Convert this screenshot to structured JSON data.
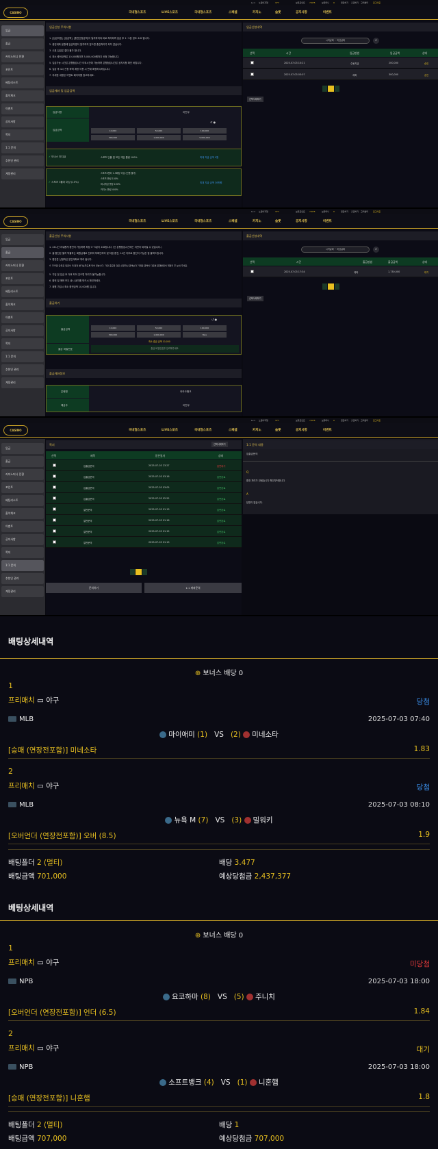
{
  "topbar": {
    "level": "Lv.1",
    "nick": "노원이지형",
    "points_label": "포인트",
    "points": "377",
    "bonus_label": "보유포인트",
    "bonus": "7,875",
    "money_label": "보유머니",
    "money": "0",
    "links": [
      "입금하기",
      "출금하기",
      "고객센터",
      "로그아웃"
    ]
  },
  "nav": {
    "logo": "CASINO",
    "items": [
      "국내형스포츠",
      "LIVE스포츠",
      "국내형스포츠",
      "스페셜",
      "카지노",
      "슬롯",
      "공지사항",
      "이벤트"
    ]
  },
  "sidebar": {
    "items": [
      "입금",
      "출금",
      "커지노머니 전환",
      "포인트",
      "베팅리스트",
      "출석체크",
      "이벤트",
      "공지사항",
      "쪽지",
      "1:1 문의",
      "추천인 관리",
      "계정관리"
    ]
  },
  "s1": {
    "sec1": "입금신청 주의사항",
    "notes": [
      "1. [입금지정], [입금액], [충전신청금액]이 일치하여야 바로 처리되며 입금 후 1~5분 정도 소요 됩니다.",
      "2. 충전계좌 문항에 입금자명이 일치하지 않으면 충전처리가 되지 않습니다.",
      "3. 수표 입금은 절대 불가 합니다.",
      "4. 최소 충전금액은 10,000원이며 5,000,000원까지 신청 가능합니다.",
      "5. 입금가능 시간은 은행점검시간 이외시간에 가능하며 은행점검시간은 공지사항 확인 바랍니다.",
      "6. 입금 후 4시 신청 하며 계정 이용 시 반재 확정하시하십니다.",
      "7. 자세한 내용은 이벤트 페이지를 참고하세요."
    ],
    "sec2": "입금계좌 및 입금금액",
    "depositor_label": "입금자명",
    "depositor": "이민우",
    "amount_label": "입금금액",
    "amounts": [
      "10,000",
      "50,000",
      "100,000",
      "300,000",
      "1,000,000",
      "5,000,000"
    ],
    "bonus1": "보너스 미지급",
    "bonus1_desc": "스포츠 단폴 및 모든 게임 롤링 100%",
    "bonus1_link": "최대 지급 금액 0원",
    "bonus2": "스포츠 3폴더 이상 (15%)",
    "bonus2_desc": [
      "스포츠3폴더 1.5배당 이상 (단폴 불가)",
      "스포츠 롤링 100%",
      "미니게임 롤링 150%",
      "카지노 롤링 400%"
    ],
    "bonus2_link": "최대 지급 금액 30만원",
    "r_sec": "입금신청내역",
    "date_from": "시작날짜",
    "date_to": "마감날짜",
    "th": [
      "선택",
      "시간",
      "입금방법",
      "입금금액",
      "상태"
    ],
    "rows": [
      [
        "2025-07-03 10:21",
        "수동지급",
        "200,000",
        "승인"
      ],
      [
        "2025-07-03 03:07",
        "계좌",
        "300,000",
        "승인"
      ]
    ],
    "page": "1",
    "del_btn": "선택삭제하기"
  },
  "s2": {
    "sec1": "출금신청 주의사항",
    "notes": [
      "1. 24시간 자유롭게 환전이 가능하며 최장 3~5분이 소요됩니다. (단 은행점검시간에는 지연이 되어질 수 있습니다.)",
      "2. 출·환전은 필히 박물하는 회원님께로 진위여 부확인하여 및 처음 환전, 14건 이후로 환전이 가능한 점 블랙드립니다.",
      "3. 환전은 신청하신 본인계좌로 처리 됩니다.",
      "4. 100원 단위로 입금이 미 환전 불가능하도록 되어 있습니다. 가장 중요한 것은 신청하신 금액보다 기재된 금액이 다르면 은행불일치 재정리 후 보내 주세요.",
      "5. 가입 및 입금 후 이후 되어 있으면 처리가 불가능합니다.",
      "6. 환전 및 매번 모두 공시 공지를 반드시 확인하세요.",
      "7. 회원 가입시 최소 환전금액 10,000원 입니다."
    ],
    "sec2": "출금하기",
    "amount_label": "출금금액",
    "amounts": [
      "10,000",
      "50,000",
      "100,000",
      "500,000",
      "1,000,000",
      "Max"
    ],
    "min_text": "최소 출금 금액 10,000",
    "pw_label": "출금 비밀번호",
    "pw_placeholder": "출금 비밀번호를 입력해주세요.",
    "sec3": "출금계좌정보",
    "bank_label": "은행명",
    "bank": "카카오뱅크",
    "holder_label": "예금주",
    "holder": "이민우",
    "r_sec": "출금신청내역",
    "date_from": "시작날짜",
    "date_to": "마감날짜",
    "th": [
      "선택",
      "시간",
      "출금방법",
      "출금금액",
      "상태"
    ],
    "rows": [
      [
        "2025-07-03 17:34",
        "계좌",
        "1,730,000",
        "대기"
      ]
    ],
    "page": "1",
    "del_btn": "선택삭제하기"
  },
  "s3": {
    "sec1": "쪽지",
    "del_btn": "선택삭제하기",
    "th": [
      "선택",
      "제목",
      "받은일자",
      "상태"
    ],
    "rows": [
      [
        "입출금문의",
        "2025-07-03 23:27",
        "답변대기"
      ],
      [
        "입출금문의",
        "2025-07-03 03:16",
        "답변완료"
      ],
      [
        "입출금문의",
        "2025-07-03 03:05",
        "답변완료"
      ],
      [
        "입출금문의",
        "2025-07-03 02:52",
        "답변완료"
      ],
      [
        "일반문의",
        "2025-07-03 01:13",
        "답변완료"
      ],
      [
        "일반문의",
        "2025-07-03 01:16",
        "답변완료"
      ],
      [
        "일반문의",
        "2025-07-03 01:15",
        "답변완료"
      ],
      [
        "일반문의",
        "2025-07-03 01:13",
        "답변완료"
      ]
    ],
    "page": "1",
    "btn_write": "문의하기",
    "btn_account": "1:1 계좌문의",
    "r_sec": "1:1 문의 내용",
    "r_title": "입출금문의",
    "q": "Q",
    "q_text": "환전 처리가 안됩습니다 확인부탁합니다",
    "a": "A",
    "a_text": "답변이 없습니다."
  },
  "d1": {
    "title": "배팅상세내역",
    "bonus": "보너스 배당 0",
    "games": [
      {
        "n": "1",
        "type": "프리매치",
        "sport": "야구",
        "status": "당첨",
        "league": "MLB",
        "time": "2025-07-03 07:40",
        "home": "마이애미",
        "hs": "(1)",
        "vs": "VS",
        "as": "(2)",
        "away": "미네소타",
        "pick": "[승패 (연장전포함)] 미네소타",
        "odd": "1.83"
      },
      {
        "n": "2",
        "type": "프리매치",
        "sport": "야구",
        "status": "당첨",
        "league": "MLB",
        "time": "2025-07-03 08:10",
        "home": "뉴욕 M",
        "hs": "(7)",
        "vs": "VS",
        "as": "(3)",
        "away": "밀워키",
        "pick": "[오버언더 (연장전포함)] 오버 (8.5)",
        "odd": "1.9"
      }
    ],
    "folder_label": "배팅폴더",
    "folder": "2 (멀티)",
    "rate_label": "배당",
    "rate": "3.477",
    "amount_label": "배팅금액",
    "amount": "701,000",
    "win_label": "예상당첨금",
    "win": "2,437,377"
  },
  "d2": {
    "title": "베팅상세내역",
    "bonus": "보너스 배당 0",
    "games": [
      {
        "n": "1",
        "type": "프리매치",
        "sport": "야구",
        "status": "미당첨",
        "league": "NPB",
        "time": "2025-07-03 18:00",
        "home": "요코하마",
        "hs": "(8)",
        "vs": "VS",
        "as": "(5)",
        "away": "주니치",
        "pick": "[오버언더 (연장전포함)] 언더 (6.5)",
        "odd": "1.84"
      },
      {
        "n": "2",
        "type": "프리매치",
        "sport": "야구",
        "status": "대기",
        "league": "NPB",
        "time": "2025-07-03 18:00",
        "home": "소프트뱅크",
        "hs": "(4)",
        "vs": "VS",
        "as": "(1)",
        "away": "니혼햄",
        "pick": "[승패 (연장전포함)] 니혼햄",
        "odd": "1.8"
      }
    ],
    "folder_label": "배팅폴더",
    "folder": "2 (멀티)",
    "rate_label": "배당",
    "rate": "1",
    "amount_label": "배팅금액",
    "amount": "707,000",
    "win_label": "예상당첨금",
    "win": "707,000"
  },
  "colors": {
    "gold": "#e8c020",
    "green": "#0d3b22",
    "win": "#3a8ee8",
    "lose": "#e03a3a",
    "wait": "#e8c020"
  }
}
